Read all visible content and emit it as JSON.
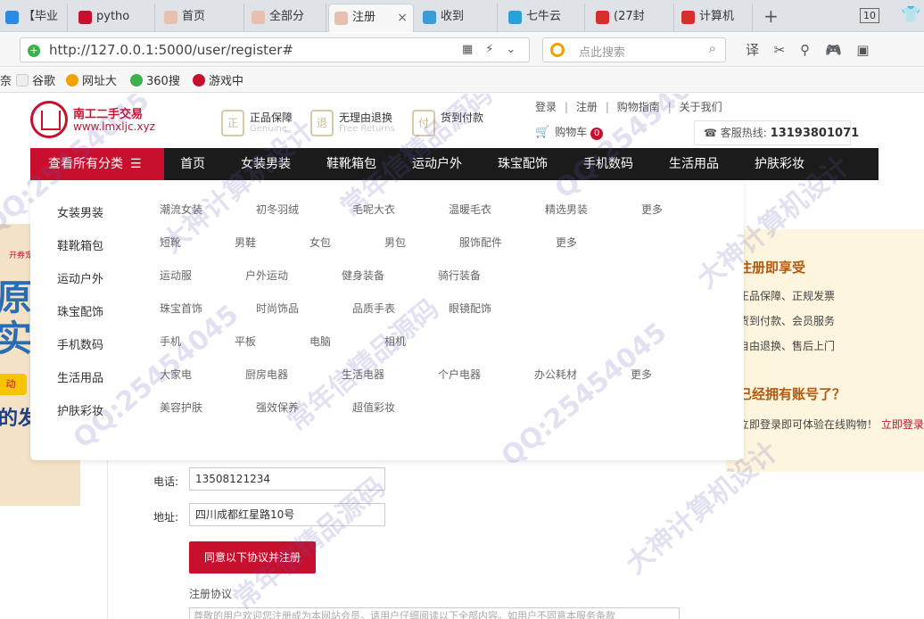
{
  "browser": {
    "tabs": [
      {
        "label": "【毕业",
        "icon_color": "#2b8ae2"
      },
      {
        "label": "pytho",
        "icon_color": "#c8102e"
      },
      {
        "label": "首页",
        "icon_color": "#e8c0b0"
      },
      {
        "label": "全部分",
        "icon_color": "#e8c0b0"
      },
      {
        "label": "注册",
        "icon_color": "#e8c0b0"
      },
      {
        "label": "收到",
        "icon_color": "#3a9bd5"
      },
      {
        "label": "七牛云",
        "icon_color": "#27a2d6"
      },
      {
        "label": "(27封",
        "icon_color": "#d62d2d"
      },
      {
        "label": "计算机",
        "icon_color": "#d62d2d"
      }
    ],
    "active_tab_close": "×",
    "new_tab": "+",
    "tab_count": "10",
    "url": "http://127.0.0.1:5000/user/register#",
    "search_placeholder": "点此搜索",
    "bookmarks": [
      {
        "label": "谷歌",
        "color": "#f0f0f0"
      },
      {
        "label": "网址大",
        "color": "#f1a200"
      },
      {
        "label": "360搜",
        "color": "#3bb24a"
      },
      {
        "label": "游戏中",
        "color": "#c8102e"
      }
    ],
    "bookmark_prefix": "奈"
  },
  "header": {
    "logo_name": "南工二手交易",
    "logo_domain": "www.lmxljc.xyz",
    "guarantees": [
      {
        "title": "正品保障",
        "sub": "Genuine"
      },
      {
        "title": "无理由退换",
        "sub": "Free Returns"
      },
      {
        "title": "货到付款",
        "sub": ""
      }
    ],
    "links": [
      "登录",
      "注册",
      "购物指南",
      "关于我们"
    ],
    "cart_label": "购物车",
    "cart_count": "0",
    "hotline_label": "客服热线:",
    "hotline_number": "13193801071"
  },
  "nav": {
    "all_categories": "查看所有分类",
    "items": [
      "首页",
      "女装男装",
      "鞋靴箱包",
      "运动户外",
      "珠宝配饰",
      "手机数码",
      "生活用品",
      "护肤彩妆"
    ]
  },
  "dropdown": {
    "categories": [
      {
        "name": "女装男装",
        "subs": [
          "潮流女装",
          "初冬羽绒",
          "毛呢大衣",
          "温暖毛衣",
          "精选男装",
          "更多"
        ]
      },
      {
        "name": "鞋靴箱包",
        "subs": [
          "短靴",
          "男鞋",
          "女包",
          "男包",
          "服饰配件",
          "更多"
        ]
      },
      {
        "name": "运动户外",
        "subs": [
          "运动服",
          "户外运动",
          "健身装备",
          "骑行装备"
        ]
      },
      {
        "name": "珠宝配饰",
        "subs": [
          "珠宝首饰",
          "时尚饰品",
          "品质手表",
          "眼镜配饰"
        ]
      },
      {
        "name": "手机数码",
        "subs": [
          "手机",
          "平板",
          "电脑",
          "相机"
        ]
      },
      {
        "name": "生活用品",
        "subs": [
          "大家电",
          "厨房电器",
          "生活电器",
          "个户电器",
          "办公耗材",
          "更多"
        ]
      },
      {
        "name": "护肤彩妆",
        "subs": [
          "美容护肤",
          "强效保养",
          "超值彩妆"
        ]
      }
    ]
  },
  "banner_left": {
    "big": "原\n实",
    "pill": "动",
    "bottom": "的发",
    "tag": "开券宠"
  },
  "right_panel": {
    "title": "注册即享受",
    "benefits": [
      "正品保障、正规发票",
      "货到付款、会员服务",
      "自由退换、售后上门"
    ],
    "have_account": "已经拥有账号了？",
    "login_text": "立即登录即可体验在线购物！",
    "login_link": "立即登录"
  },
  "form": {
    "phone_label": "电话:",
    "phone_value": "13508121234",
    "address_label": "地址:",
    "address_value": "四川成都红星路10号",
    "submit_label": "同意以下协议并注册",
    "agreement_title": "注册协议",
    "agreement_preview": "尊敬的用户欢迎您注册成为本网站会员。请用户仔细阅读以下全部内容。如用户不同意本服务条款"
  },
  "watermarks": [
    "QQ:25454045",
    "大神计算机设计",
    "常年信精品源码",
    "QQ:25454045",
    "大神计算机设计",
    "QQ:25454045",
    "常年信精品源码",
    "QQ:25454045",
    "大神计算机设计",
    "常年信精品源码"
  ]
}
